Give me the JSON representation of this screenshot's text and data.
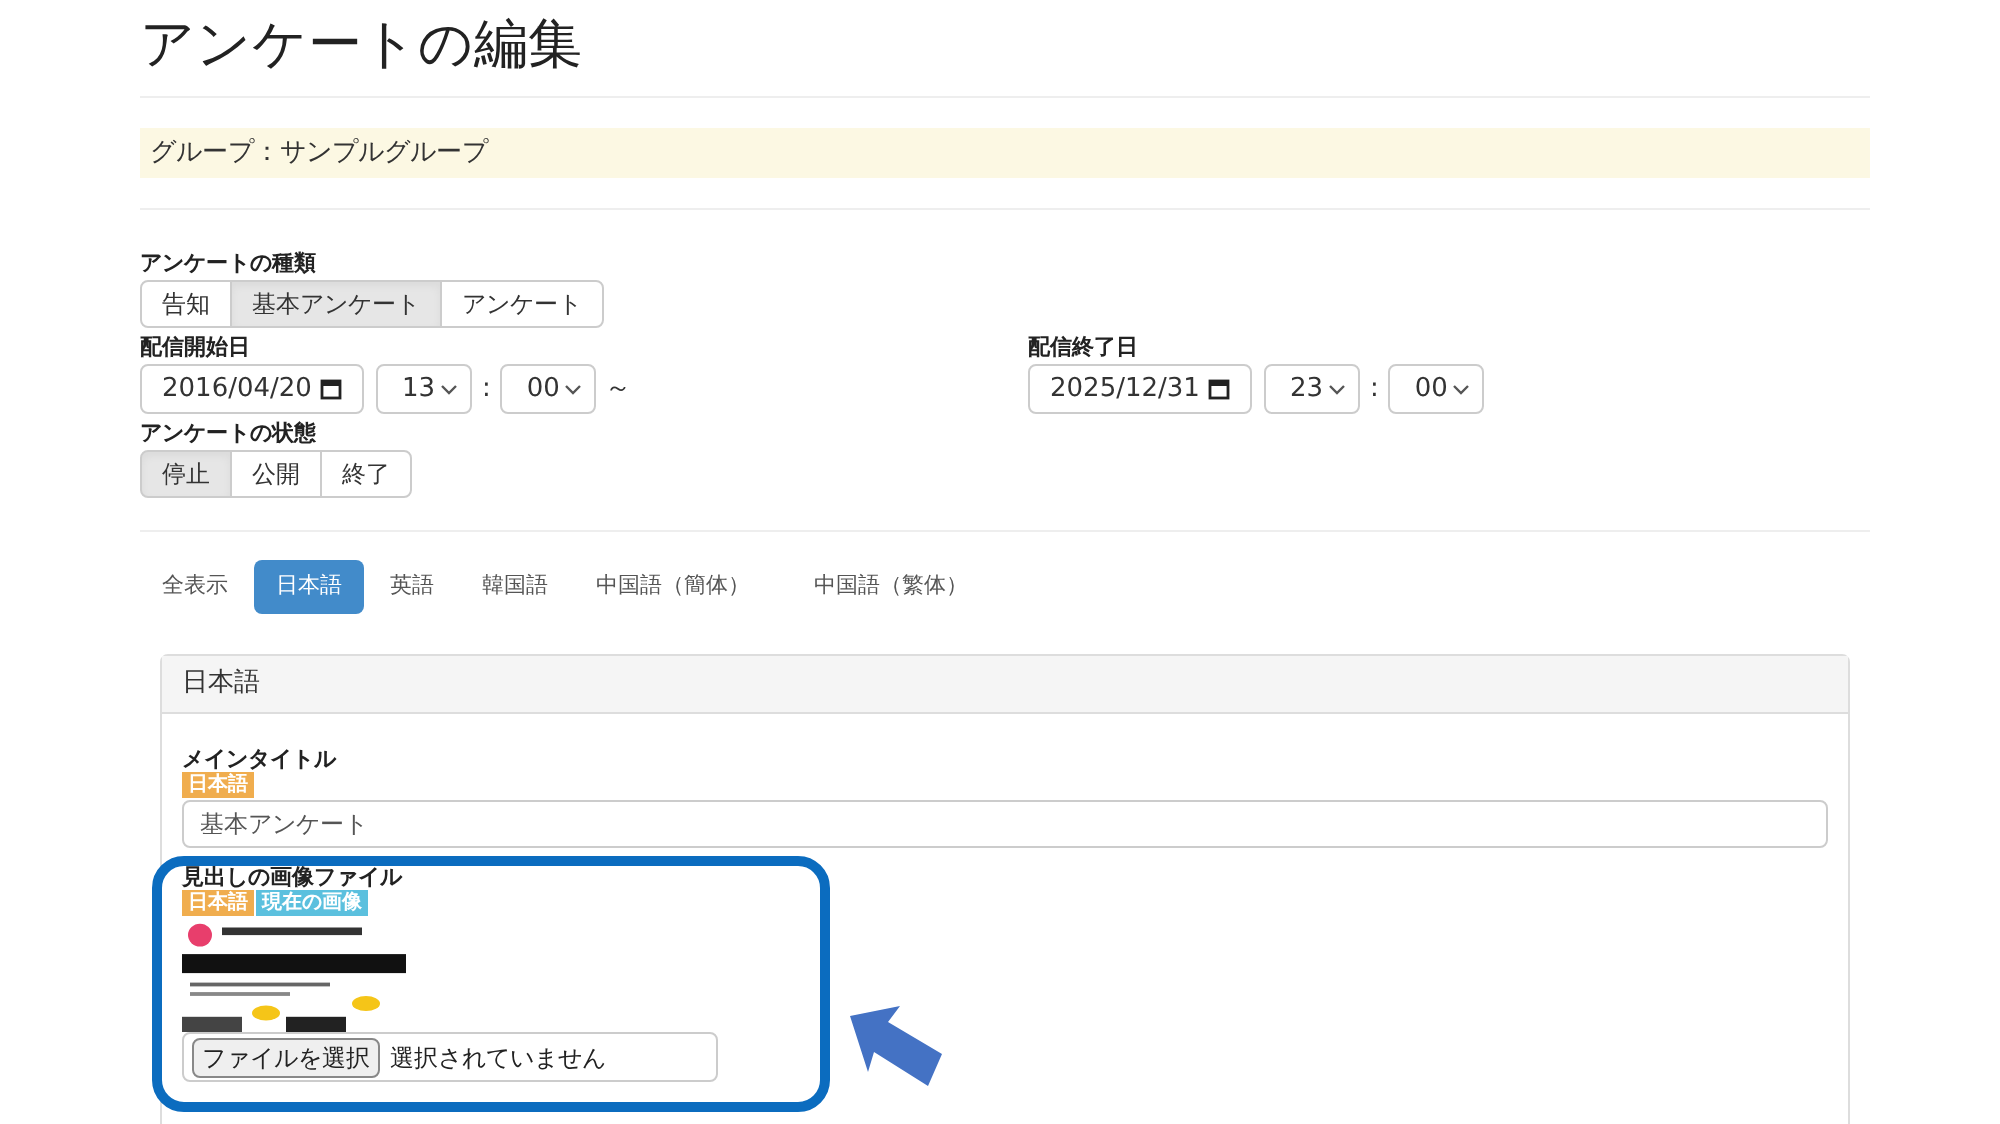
{
  "title": "アンケートの編集",
  "group": "グループ：サンプルグループ",
  "survey_type": {
    "label": "アンケートの種類",
    "options": [
      {
        "label": "告知",
        "selected": false
      },
      {
        "label": "基本アンケート",
        "selected": true
      },
      {
        "label": "アンケート",
        "selected": false
      }
    ]
  },
  "start": {
    "label": "配信開始日",
    "date": "2016/04/20",
    "hour": "13",
    "separator": ":",
    "minute": "00",
    "tilde": "～"
  },
  "end": {
    "label": "配信終了日",
    "date": "2025/12/31",
    "hour": "23",
    "separator": ":",
    "minute": "00"
  },
  "status": {
    "label": "アンケートの状態",
    "options": [
      {
        "label": "停止",
        "selected": true
      },
      {
        "label": "公開",
        "selected": false
      },
      {
        "label": "終了",
        "selected": false
      }
    ]
  },
  "language_tabs": [
    {
      "label": "全表示",
      "selected": false
    },
    {
      "label": "日本語",
      "selected": true
    },
    {
      "label": "英語",
      "selected": false
    },
    {
      "label": "韓国語",
      "selected": false
    },
    {
      "label": "中国語（簡体）",
      "selected": false
    },
    {
      "label": "中国語（繁体）",
      "selected": false
    }
  ],
  "panel": {
    "heading": "日本語",
    "main_title": {
      "label": "メインタイトル",
      "badges": [
        {
          "text": "日本語",
          "color": "#f0ad4e"
        }
      ],
      "value": "基本アンケート"
    },
    "heading_image": {
      "label": "見出しの画像ファイル",
      "badges": [
        {
          "text": "日本語",
          "color": "#f0ad4e"
        },
        {
          "text": "現在の画像",
          "color": "#5bc0de"
        }
      ],
      "file_button": "ファイルを選択",
      "file_status": "選択されていません"
    }
  }
}
